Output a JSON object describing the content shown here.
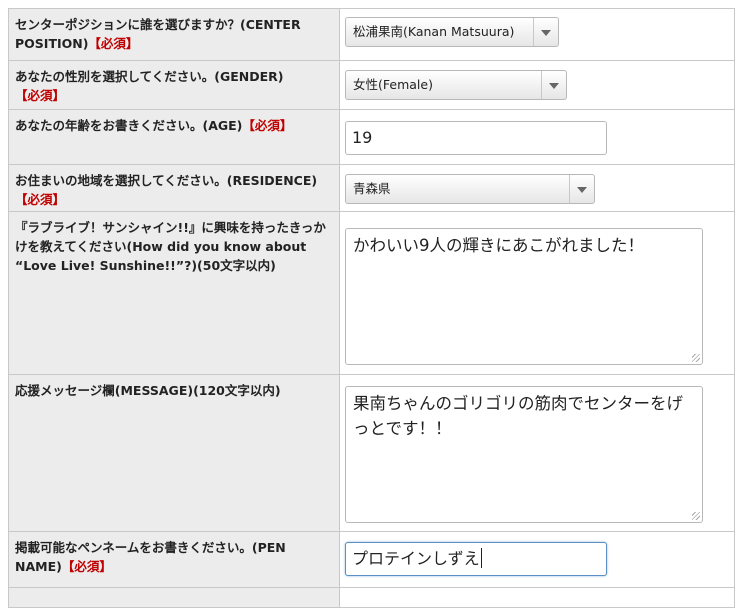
{
  "rows": [
    {
      "label": "センターポジションに誰を選びますか？(CENTER POSITION)",
      "required": "【必須】",
      "control": "select",
      "value": "松浦果南(Kanan Matsuura)"
    },
    {
      "label": "あなたの性別を選択してください。(GENDER)",
      "required": "【必須】",
      "control": "select",
      "value": "女性(Female)"
    },
    {
      "label": "あなたの年齢をお書きください。(AGE)",
      "required": "【必須】",
      "control": "text",
      "value": "19"
    },
    {
      "label": "お住まいの地域を選択してください。(RESIDENCE)",
      "required": "【必須】",
      "control": "select",
      "value": "青森県"
    },
    {
      "label": "『ラブライブ！サンシャイン!!』に興味を持ったきっかけを教えてください(How did you know about “Love Live! Sunshine!!”?)(50文字以内)",
      "required": "",
      "control": "textarea",
      "value": "かわいい9人の輝きにあこがれました！"
    },
    {
      "label": "応援メッセージ欄(MESSAGE)(120文字以内)",
      "required": "",
      "control": "textarea",
      "value": "果南ちゃんのゴリゴリの筋肉でセンターをげっとです！！"
    },
    {
      "label": "掲載可能なペンネームをお書きください。(PEN NAME)",
      "required": "【必須】",
      "control": "text",
      "value": "プロテインしずえ"
    }
  ],
  "colors": {
    "required": "#c00000",
    "label_background": "#ececec",
    "focus_border": "#5b8fc6"
  }
}
